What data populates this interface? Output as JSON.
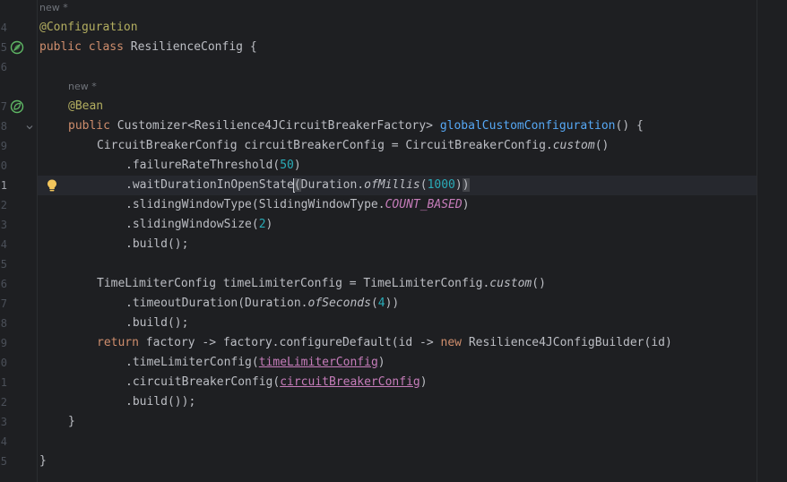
{
  "gutter": {
    "line_numbers": [
      "4",
      "5",
      "6",
      "",
      "7",
      "8",
      "9",
      "0",
      "1",
      "2",
      "3",
      "4",
      "5",
      "6",
      "7",
      "8",
      "9",
      "0",
      "1",
      "2",
      "3",
      "4",
      "5"
    ],
    "icons": {
      "class_spring_bean_icon": "leaf-bean-icon",
      "method_spring_bean_icon": "leaf-bean-icon",
      "intention_icon": "lightbulb-icon",
      "fold_icon": "chevron-down-icon"
    }
  },
  "hints": {
    "class_author_hint": "new *",
    "method_author_hint": "new *"
  },
  "code": {
    "l_annotation_config": "@Configuration",
    "l_class_kw_public": "public",
    "l_class_kw_class": "class",
    "l_class_name": "ResilienceConfig {",
    "l_bean_annotation": "@Bean",
    "l_method_kw_public": "public",
    "l_method_return": "Customizer<Resilience4JCircuitBreakerFactory>",
    "l_method_name": "globalCustomConfiguration",
    "l_method_tail": "() {",
    "l_cbc_decl": "CircuitBreakerConfig circuitBreakerConfig = CircuitBreakerConfig.",
    "l_cbc_custom": "custom",
    "l_cbc_paren": "()",
    "l_frt_call": ".failureRateThreshold(",
    "l_frt_num": "50",
    "l_frt_close": ")",
    "l_wait_call_a": ".waitDurationInOpenState",
    "l_wait_open": "(",
    "l_wait_dur": "Duration.",
    "l_wait_ofmillis": "ofMillis",
    "l_wait_p": "(",
    "l_wait_num": "1000",
    "l_wait_close1": ")",
    "l_wait_close2": ")",
    "l_swt_call": ".slidingWindowType(SlidingWindowType.",
    "l_swt_const": "COUNT_BASED",
    "l_swt_close": ")",
    "l_sws_call": ".slidingWindowSize(",
    "l_sws_num": "2",
    "l_sws_close": ")",
    "l_build1": ".build();",
    "l_tlc_decl": "TimeLimiterConfig timeLimiterConfig = TimeLimiterConfig.",
    "l_tlc_custom": "custom",
    "l_tlc_paren": "()",
    "l_to_call": ".timeoutDuration(Duration.",
    "l_to_ofsec": "ofSeconds",
    "l_to_p": "(",
    "l_to_num": "4",
    "l_to_close": "))",
    "l_build2": ".build();",
    "l_ret_kw": "return",
    "l_ret_mid": "factory -> factory.configureDefault(id ->",
    "l_ret_new": "new",
    "l_ret_tail": "Resilience4JConfigBuilder(id)",
    "l_tlc_call": ".timeLimiterConfig(",
    "l_tlc_param": "timeLimiterConfig",
    "l_tlc_close": ")",
    "l_cbc_call": ".circuitBreakerConfig(",
    "l_cbc_param": "circuitBreakerConfig",
    "l_cbc_close": ")",
    "l_build3": ".build());",
    "l_method_end": "}",
    "l_class_end": "}"
  },
  "colors": {
    "background": "#1e1f22",
    "annotation": "#b3ae60",
    "keyword": "#cf8e6d",
    "method_decl": "#56a8f5",
    "number": "#2aacb8",
    "constant_param": "#c77dbb",
    "text": "#bcbec4"
  }
}
